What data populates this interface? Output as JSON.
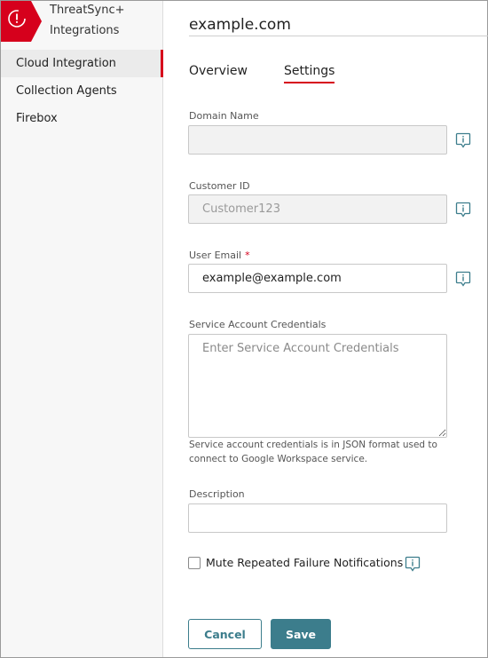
{
  "brand": {
    "title": "ThreatSync+",
    "subtitle": "Integrations",
    "accent": "#d6001c"
  },
  "sidebar": {
    "items": [
      {
        "label": "Cloud Integration",
        "active": true
      },
      {
        "label": "Collection Agents",
        "active": false
      },
      {
        "label": "Firebox",
        "active": false
      }
    ]
  },
  "header": {
    "title": "example.com"
  },
  "tabs": [
    {
      "label": "Overview",
      "active": false
    },
    {
      "label": "Settings",
      "active": true
    }
  ],
  "form": {
    "domain_name": {
      "label": "Domain Name",
      "value": "",
      "placeholder": ""
    },
    "customer_id": {
      "label": "Customer ID",
      "value": "Customer123",
      "disabled": true
    },
    "user_email": {
      "label": "User Email",
      "required_mark": "*",
      "value": "example@example.com"
    },
    "service_credentials": {
      "label": "Service Account Credentials",
      "placeholder": "Enter Service Account Credentials",
      "help": "Service account credentials is in JSON format used to connect to Google Workspace service."
    },
    "description": {
      "label": "Description",
      "value": ""
    },
    "mute_notifications": {
      "label": "Mute Repeated Failure Notifications",
      "checked": false
    }
  },
  "buttons": {
    "cancel_label": "Cancel",
    "save_label": "Save",
    "primary_color": "#3c7d8c"
  },
  "icons": {
    "brand": "alert-sync-icon",
    "info": "info-icon"
  }
}
